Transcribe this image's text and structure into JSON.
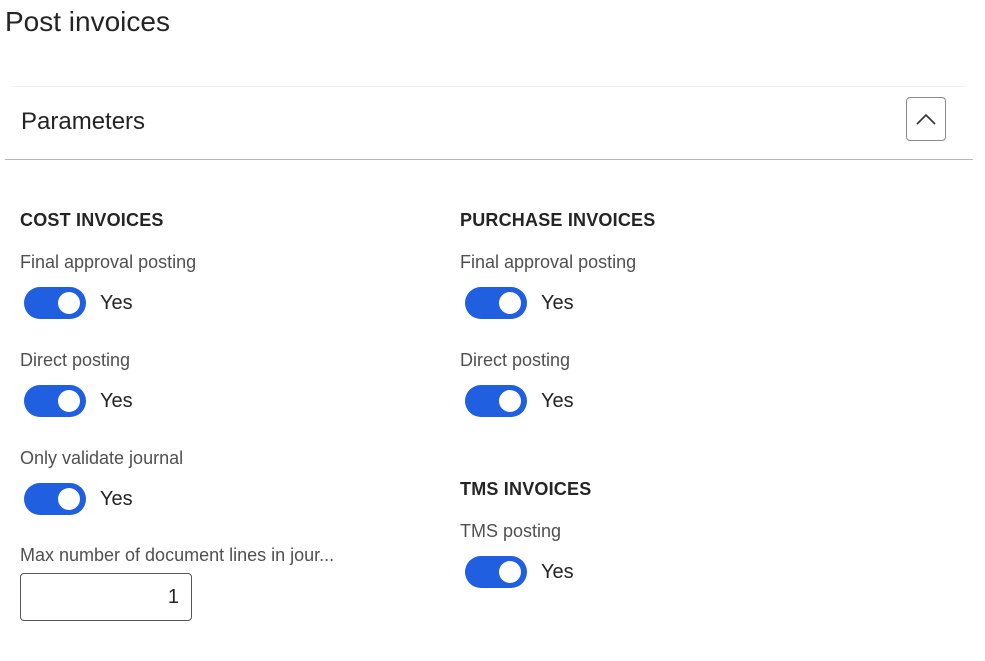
{
  "page": {
    "title": "Post invoices"
  },
  "section": {
    "title": "Parameters"
  },
  "cost_invoices": {
    "heading": "COST INVOICES",
    "final_approval_posting": {
      "label": "Final approval posting",
      "state": "Yes",
      "on": true
    },
    "direct_posting": {
      "label": "Direct posting",
      "state": "Yes",
      "on": true
    },
    "only_validate_journal": {
      "label": "Only validate journal",
      "state": "Yes",
      "on": true
    },
    "max_document_lines": {
      "label": "Max number of document lines in jour...",
      "value": "1"
    }
  },
  "purchase_invoices": {
    "heading": "PURCHASE INVOICES",
    "final_approval_posting": {
      "label": "Final approval posting",
      "state": "Yes",
      "on": true
    },
    "direct_posting": {
      "label": "Direct posting",
      "state": "Yes",
      "on": true
    }
  },
  "tms_invoices": {
    "heading": "TMS INVOICES",
    "tms_posting": {
      "label": "TMS posting",
      "state": "Yes",
      "on": true
    }
  },
  "colors": {
    "toggle_on": "#1f5fe0",
    "text": "#242424",
    "label": "#505050"
  }
}
